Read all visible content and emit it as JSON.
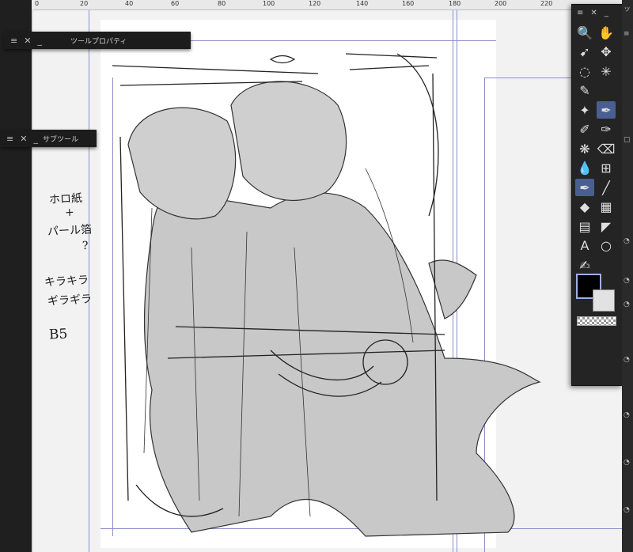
{
  "ruler": {
    "labels": [
      "0",
      "20",
      "40",
      "60",
      "80",
      "100",
      "120",
      "140",
      "160",
      "180",
      "200",
      "220"
    ]
  },
  "panels": {
    "tool_property": {
      "title": "ツールプロパティ",
      "menu_icon": "≡",
      "close_icon": "✕",
      "min_icon": "_"
    },
    "sub_tool": {
      "title": "サブツール",
      "menu_icon": "≡",
      "close_icon": "✕",
      "min_icon": "_"
    },
    "toolbox": {
      "menu_icon": "≡",
      "close_icon": "✕",
      "min_icon": "_",
      "extra": "ッ"
    }
  },
  "tools": [
    {
      "name": "zoom-icon",
      "glyph": "🔍",
      "active": false
    },
    {
      "name": "hand-icon",
      "glyph": "✋",
      "active": false
    },
    {
      "name": "object-select-icon",
      "glyph": "➹",
      "active": false
    },
    {
      "name": "move-layer-icon",
      "glyph": "✥",
      "active": false
    },
    {
      "name": "lasso-icon",
      "glyph": "◌",
      "active": false
    },
    {
      "name": "auto-select-icon",
      "glyph": "✳",
      "active": false
    },
    {
      "name": "eyedropper-icon",
      "glyph": "✎",
      "active": false
    },
    {
      "name": "blank-slot",
      "glyph": "",
      "active": false
    },
    {
      "name": "sparkle-icon",
      "glyph": "✦",
      "active": false
    },
    {
      "name": "pen-icon",
      "glyph": "✒",
      "active": true
    },
    {
      "name": "pencil-icon",
      "glyph": "✐",
      "active": false
    },
    {
      "name": "brush-icon",
      "glyph": "✑",
      "active": false
    },
    {
      "name": "airbrush-icon",
      "glyph": "❋",
      "active": false
    },
    {
      "name": "eraser-icon",
      "glyph": "⌫",
      "active": false
    },
    {
      "name": "blend-icon",
      "glyph": "💧",
      "active": false
    },
    {
      "name": "grid-icon",
      "glyph": "⊞",
      "active": false
    },
    {
      "name": "decoration-icon",
      "glyph": "✒",
      "active": true
    },
    {
      "name": "line-icon",
      "glyph": "╱",
      "active": false
    },
    {
      "name": "fill-icon",
      "glyph": "◆",
      "active": false
    },
    {
      "name": "gradient-icon",
      "glyph": "▦",
      "active": false
    },
    {
      "name": "frame-icon",
      "glyph": "▤",
      "active": false
    },
    {
      "name": "ruler-icon",
      "glyph": "◤",
      "active": false
    },
    {
      "name": "text-icon",
      "glyph": "A",
      "active": false
    },
    {
      "name": "balloon-icon",
      "glyph": "○",
      "active": false
    },
    {
      "name": "correction-icon",
      "glyph": "✍",
      "active": false
    }
  ],
  "colors": {
    "main": "#000000",
    "sub": "#e2e2e2",
    "accent": "#4a5f91"
  },
  "notes": {
    "line1": "ホロ紙",
    "line2": "+",
    "line3": "パール箔",
    "line4": "?",
    "line5": "キラキラ",
    "line6": "ギラギラ",
    "line7": "B5"
  }
}
